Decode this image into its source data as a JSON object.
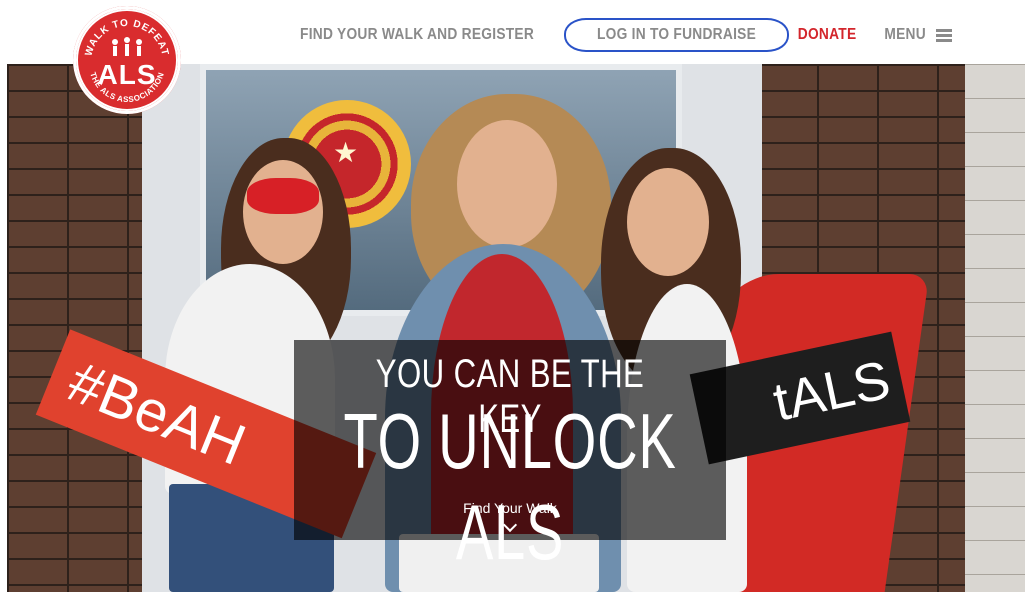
{
  "logo": {
    "top_text": "WALK TO DEFEAT",
    "main_text": "ALS",
    "bottom_text": "THE ALS ASSOCIATION"
  },
  "nav": {
    "find_walk": "FIND YOUR WALK AND REGISTER",
    "login": "LOG IN TO FUNDRAISE",
    "donate": "DONATE",
    "menu": "MENU"
  },
  "hero": {
    "headline_line1": "YOU CAN BE THE KEY",
    "headline_line2": "TO UNLOCK ALS",
    "cta": "Find Your Walk",
    "sign_left": "#BeAH",
    "sign_right": "tALS"
  },
  "colors": {
    "brand_red": "#d92c2e",
    "donate_red": "#d3262c",
    "nav_gray": "#8a8a8a",
    "highlight_blue": "#2a53c8"
  },
  "icons": {
    "menu": "hamburger-icon",
    "cta": "chevron-down-icon"
  }
}
